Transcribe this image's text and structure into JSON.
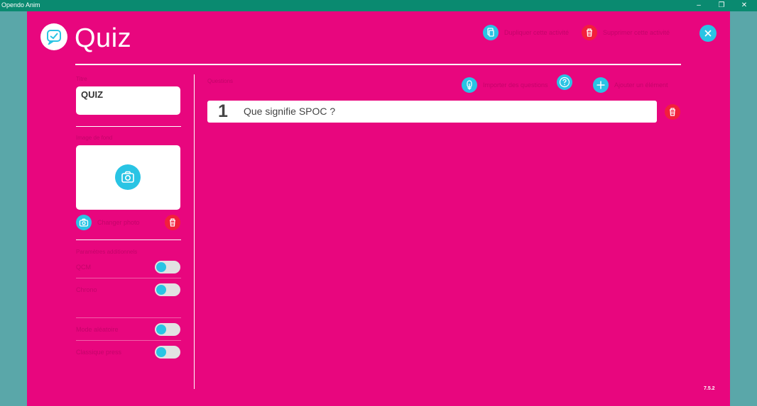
{
  "window": {
    "title": "Opendo Anim"
  },
  "header": {
    "page_title": "Quiz",
    "duplicate_label": "Dupliquer cette activité",
    "delete_label": "Supprimer cette activité"
  },
  "left": {
    "title_label": "Titre",
    "title_value": "QUIZ",
    "cover_label": "Image de fond",
    "change_photo_label": "Changer photo",
    "options_label": "Paramètres additionnels",
    "toggles": [
      {
        "label": "QCM",
        "on": false
      },
      {
        "label": "Chrono",
        "on": false
      },
      {
        "label": "Mode aléatoire",
        "on": false
      },
      {
        "label": "Classique press",
        "on": false
      }
    ]
  },
  "questions": {
    "section_label": "Questions",
    "import_label": "Importer des questions",
    "add_label": "Ajouter un élément",
    "items": [
      {
        "number": "1",
        "text": "Que signifie SPOC ?"
      }
    ]
  },
  "footer": {
    "version": "7.5.2"
  },
  "colors": {
    "accent_bg": "#e8067e",
    "cyan": "#29c4e4",
    "red": "#f21f3c",
    "side": "#5aa7a9",
    "titlebar": "#0a8a70"
  },
  "icons": [
    "check-chat-icon",
    "copy-icon",
    "trash-icon",
    "close-icon",
    "camera-icon",
    "download-icon",
    "help-icon",
    "plus-icon"
  ]
}
